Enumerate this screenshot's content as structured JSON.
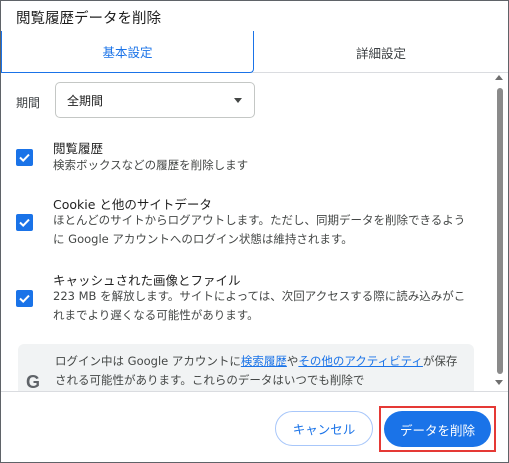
{
  "dialog": {
    "title": "閲覧履歴データを削除"
  },
  "tabs": [
    {
      "label": "基本設定",
      "active": true
    },
    {
      "label": "詳細設定",
      "active": false
    }
  ],
  "period": {
    "label": "期間",
    "selected": "全期間"
  },
  "items": [
    {
      "title": "閲覧履歴",
      "description": "検索ボックスなどの履歴を削除します",
      "checked": true
    },
    {
      "title": "Cookie と他のサイトデータ",
      "description": "ほとんどのサイトからログアウトします。ただし、同期データを削除できるように Google アカウントへのログイン状態は維持されます。",
      "checked": true
    },
    {
      "title": "キャッシュされた画像とファイル",
      "description": "223 MB を解放します。サイトによっては、次回アクセスする際に読み込みがこれまでより遅くなる可能性があります。",
      "checked": true
    }
  ],
  "info": {
    "icon": "google-g-icon",
    "icon_glyph": "G",
    "text_before": "ログイン中は Google アカウントに",
    "link1": "検索履歴",
    "text_mid": "や",
    "link2": "その他のアクティビティ",
    "text_after": "が保存される可能性があります。これらのデータはいつでも削除で"
  },
  "buttons": {
    "cancel": "キャンセル",
    "delete": "データを削除"
  },
  "colors": {
    "accent": "#1a73e8",
    "highlight_border": "#e53935"
  }
}
